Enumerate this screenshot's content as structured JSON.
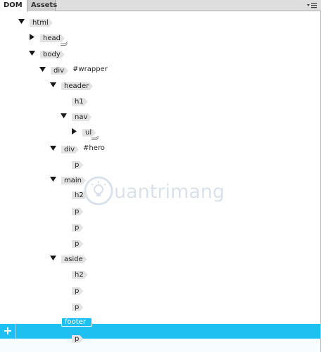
{
  "tabs": {
    "dom": "DOM",
    "assets": "Assets"
  },
  "watermark": {
    "text": "uantrimang"
  },
  "tree": {
    "nodes": [
      {
        "tag": "html",
        "ident": "",
        "toggle": "expanded",
        "stacked": false
      },
      {
        "tag": "head",
        "ident": "",
        "toggle": "collapsed",
        "stacked": true
      },
      {
        "tag": "body",
        "ident": "",
        "toggle": "expanded",
        "stacked": false
      },
      {
        "tag": "div",
        "ident": "#wrapper",
        "toggle": "expanded",
        "stacked": false
      },
      {
        "tag": "header",
        "ident": "",
        "toggle": "expanded",
        "stacked": false
      },
      {
        "tag": "h1",
        "ident": "",
        "toggle": "none",
        "stacked": false
      },
      {
        "tag": "nav",
        "ident": "",
        "toggle": "expanded",
        "stacked": false
      },
      {
        "tag": "ul",
        "ident": "",
        "toggle": "collapsed",
        "stacked": true
      },
      {
        "tag": "div",
        "ident": "#hero",
        "toggle": "expanded",
        "stacked": false
      },
      {
        "tag": "p",
        "ident": "",
        "toggle": "none",
        "stacked": false
      },
      {
        "tag": "main",
        "ident": "",
        "toggle": "expanded",
        "stacked": false
      },
      {
        "tag": "h2",
        "ident": "",
        "toggle": "none",
        "stacked": false
      },
      {
        "tag": "p",
        "ident": "",
        "toggle": "none",
        "stacked": false
      },
      {
        "tag": "p",
        "ident": "",
        "toggle": "none",
        "stacked": false
      },
      {
        "tag": "p",
        "ident": "",
        "toggle": "none",
        "stacked": false
      },
      {
        "tag": "aside",
        "ident": "",
        "toggle": "expanded",
        "stacked": false
      },
      {
        "tag": "h2",
        "ident": "",
        "toggle": "none",
        "stacked": false
      },
      {
        "tag": "p",
        "ident": "",
        "toggle": "none",
        "stacked": false
      },
      {
        "tag": "p",
        "ident": "",
        "toggle": "none",
        "stacked": false
      },
      {
        "tag": "footer",
        "ident": "",
        "toggle": "expanded",
        "stacked": false,
        "selected": true
      },
      {
        "tag": "p",
        "ident": "",
        "toggle": "none",
        "stacked": false
      }
    ]
  },
  "colors": {
    "selection": "#1ec0f2",
    "tag_bg": "#e3e3e3",
    "tab_bar": "#dedede"
  },
  "icons": {
    "panel_menu": "panel-menu-icon",
    "add": "plus-icon",
    "expand": "triangle-down-icon",
    "collapse": "triangle-right-icon"
  }
}
